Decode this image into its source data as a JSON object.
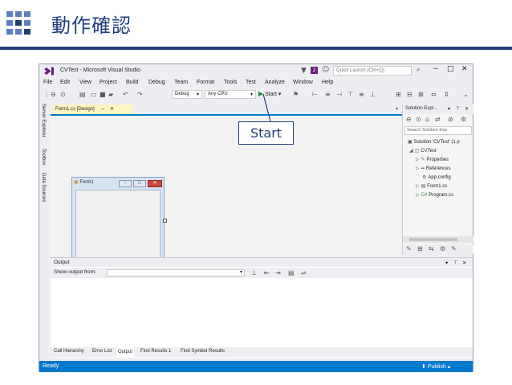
{
  "slide": {
    "title": "動作確認",
    "accent": "#1f3e79"
  },
  "vs": {
    "title": "CVTest - Microsoft Visual Studio",
    "notification_count": "2",
    "quick_launch_placeholder": "Quick Launch (Ctrl+Q)",
    "menu": [
      "File",
      "Edit",
      "View",
      "Project",
      "Build",
      "Debug",
      "Team",
      "Format",
      "Tools",
      "Test",
      "Analyze",
      "Window",
      "Help"
    ],
    "toolbar": {
      "config": "Debug",
      "platform": "Any CPU",
      "start_label": "Start"
    },
    "left_tabs": [
      "Server Explorer",
      "Toolbox",
      "Data Sources"
    ],
    "doc_tab": "Form1.cs [Design]",
    "form_caption": "Form1",
    "solution_explorer": {
      "title": "Solution Expl...",
      "search_placeholder": "Search Solution Exp",
      "items": [
        {
          "label": "Solution 'CVTest' (1 p",
          "icon": "solution-icon"
        },
        {
          "label": "CVTest",
          "icon": "csharp-project-icon"
        },
        {
          "label": "Properties",
          "icon": "wrench-icon"
        },
        {
          "label": "References",
          "icon": "references-icon"
        },
        {
          "label": "App.config",
          "icon": "config-icon"
        },
        {
          "label": "Form1.cs",
          "icon": "form-icon"
        },
        {
          "label": "Program.cs",
          "icon": "csharp-file-icon"
        }
      ]
    },
    "output": {
      "title": "Output",
      "show_from_label": "Show output from:"
    },
    "bottom_tabs": [
      "Call Hierarchy",
      "Error List",
      "Output",
      "Find Results 1",
      "Find Symbol Results"
    ],
    "active_bottom_tab": "Output",
    "status": {
      "left": "Ready",
      "publish": "Publish"
    },
    "colors": {
      "status_bar": "#007acc",
      "purple": "#68217a"
    }
  },
  "annotation": {
    "label": "Start"
  }
}
